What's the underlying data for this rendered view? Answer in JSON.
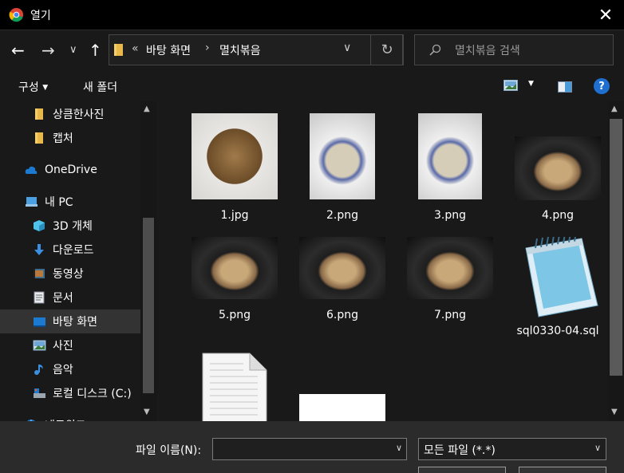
{
  "window": {
    "title": "열기",
    "close_glyph": "✕"
  },
  "nav": {
    "back": "←",
    "forward": "→",
    "recent": "∨",
    "up": "↑",
    "breadcrumb": [
      "«",
      "바탕 화면",
      "›",
      "멸치볶음"
    ],
    "address_dropdown": "∨",
    "refresh": "↻",
    "search_placeholder": "멸치볶음 검색"
  },
  "toolbar": {
    "organize": "구성",
    "new_folder": "새 폴더",
    "help": "?"
  },
  "sidebar": {
    "items": [
      {
        "label": "상큼한사진",
        "icon": "folder-icon"
      },
      {
        "label": "캡처",
        "icon": "folder-icon"
      },
      {
        "label": "OneDrive",
        "icon": "cloud-icon"
      },
      {
        "label": "내 PC",
        "icon": "pc-icon"
      },
      {
        "label": "3D 개체",
        "icon": "cube-icon"
      },
      {
        "label": "다운로드",
        "icon": "download-icon"
      },
      {
        "label": "동영상",
        "icon": "video-icon"
      },
      {
        "label": "문서",
        "icon": "document-icon"
      },
      {
        "label": "바탕 화면",
        "icon": "desktop-icon",
        "selected": true
      },
      {
        "label": "사진",
        "icon": "pictures-icon"
      },
      {
        "label": "음악",
        "icon": "music-icon"
      },
      {
        "label": "로컬 디스크 (C:)",
        "icon": "drive-icon"
      },
      {
        "label": "네트워크",
        "icon": "network-icon"
      }
    ]
  },
  "files": [
    {
      "name": "1.jpg",
      "kind": "photo-dark"
    },
    {
      "name": "2.png",
      "kind": "photo-plate"
    },
    {
      "name": "3.png",
      "kind": "photo-plate"
    },
    {
      "name": "4.png",
      "kind": "photo-pan"
    },
    {
      "name": "5.png",
      "kind": "photo-pan"
    },
    {
      "name": "6.png",
      "kind": "photo-pan"
    },
    {
      "name": "7.png",
      "kind": "photo-pan"
    },
    {
      "name": "sql0330-04.sql",
      "kind": "notepad"
    },
    {
      "name": "",
      "kind": "blank-doc"
    },
    {
      "name": "",
      "kind": "screenshot"
    }
  ],
  "footer": {
    "filename_label": "파일 이름(N):",
    "filename_value": "",
    "filetype_value": "모든 파일 (*.*)"
  },
  "colors": {
    "background": "#191919",
    "selection": "#333333",
    "accent": "#0078d7"
  }
}
